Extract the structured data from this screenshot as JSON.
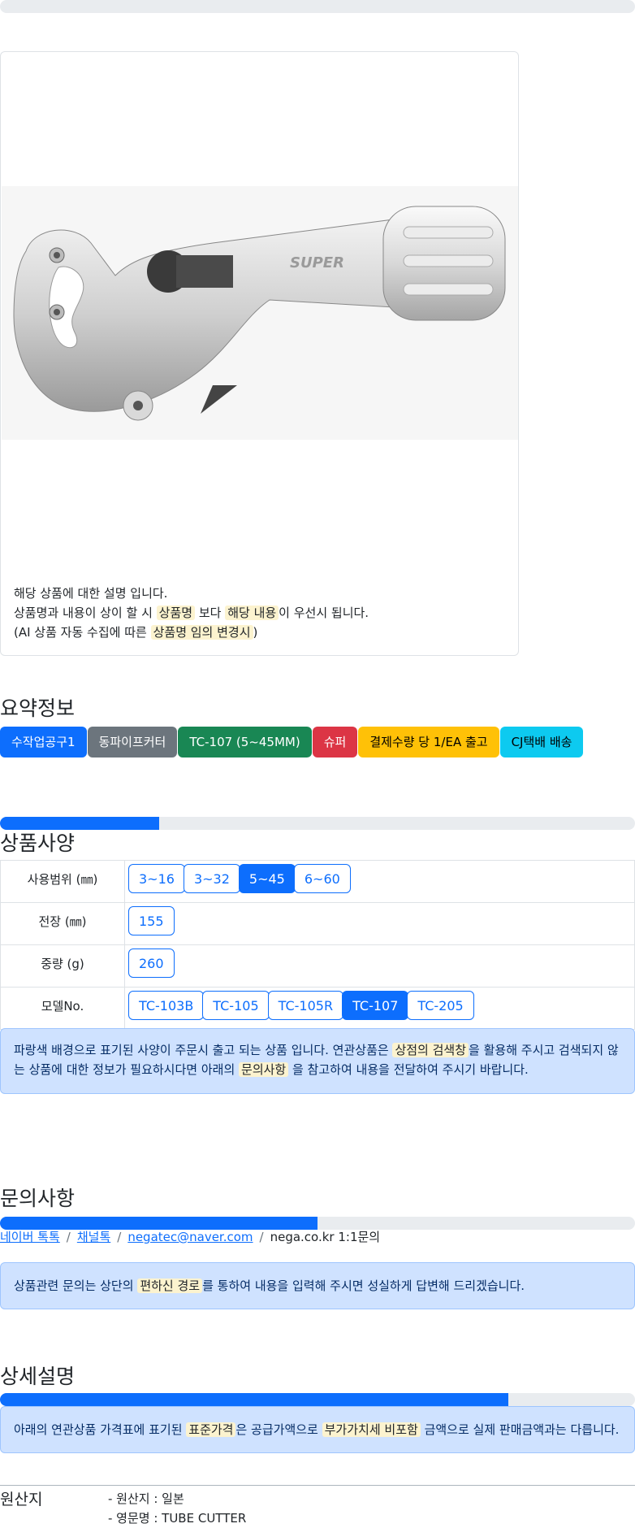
{
  "card": {
    "line1": "해당 상품에 대한 설명 입니다.",
    "line2_a": "상품명과 내용이 상이 할 시 ",
    "line2_mark1": "상품명",
    "line2_b": " 보다 ",
    "line2_mark2": "해당 내용",
    "line2_c": "이 우선시 됩니다.",
    "line3_a": "(AI 상품 자동 수집에 따른 ",
    "line3_mark": "상품명 임의 변경시",
    "line3_b": ")"
  },
  "summary": {
    "title": "요약정보",
    "badges": [
      {
        "label": "수작업공구1",
        "color": "#0d6efd",
        "text": "#ffffff"
      },
      {
        "label": "동파이프커터",
        "color": "#6c757d",
        "text": "#ffffff"
      },
      {
        "label": "TC-107 (5~45MM)",
        "color": "#198754",
        "text": "#ffffff"
      },
      {
        "label": "슈퍼",
        "color": "#dc3545",
        "text": "#ffffff"
      },
      {
        "label": "결제수량 당 1/EA 출고",
        "color": "#ffc107",
        "text": "#000000"
      },
      {
        "label": "CJ택배 배송",
        "color": "#0dcaf0",
        "text": "#000000"
      }
    ]
  },
  "spec": {
    "title": "상품사양",
    "progress": 0.25,
    "rows": [
      {
        "label": "사용범위 (㎜)",
        "options": [
          "3~16",
          "3~32",
          "5~45",
          "6~60"
        ],
        "selected": 2
      },
      {
        "label": "전장 (㎜)",
        "options": [
          "155"
        ],
        "selected": -1
      },
      {
        "label": "중량 (g)",
        "options": [
          "260"
        ],
        "selected": -1
      },
      {
        "label": "모델No.",
        "options": [
          "TC-103B",
          "TC-105",
          "TC-105R",
          "TC-107",
          "TC-205"
        ],
        "selected": 3
      }
    ],
    "notice_a": "파랑색 배경으로 표기된 사양이 주문시 출고 되는 상품 입니다. 연관상품은 ",
    "notice_mark1": "상점의 검색창",
    "notice_b": "을 활용해 주시고 검색되지 않는 상품에 대한 정보가 필요하시다면 아래의 ",
    "notice_mark2": "문의사항",
    "notice_c": " 을 참고하여 내용을 전달하여 주시기 바랍니다."
  },
  "inquiry": {
    "title": "문의사항",
    "progress": 0.5,
    "link1": "네이버 톡톡",
    "link2": "채널톡",
    "link3": "negatec@naver.com",
    "plain": "nega.co.kr 1:1문의",
    "sep": "/",
    "notice_a": "상품관련 문의는 상단의 ",
    "notice_mark": "편하신 경로",
    "notice_b": "를 통하여 내용을 입력해 주시면 성실하게 답변해 드리겠습니다."
  },
  "detail": {
    "title": "상세설명",
    "progress": 0.8,
    "notice_a": "아래의 연관상품 가격표에 표기된 ",
    "notice_mark1": "표준가격",
    "notice_b": "은 공급가액으로 ",
    "notice_mark2": "부가가치세 비포함",
    "notice_c": " 금액으로 실제 판매금액과는 다릅니다."
  },
  "origin": {
    "label": "원산지",
    "items": [
      "- 원산지 : 일본",
      "- 영문명 : TUBE CUTTER"
    ]
  },
  "top_progress": 0
}
